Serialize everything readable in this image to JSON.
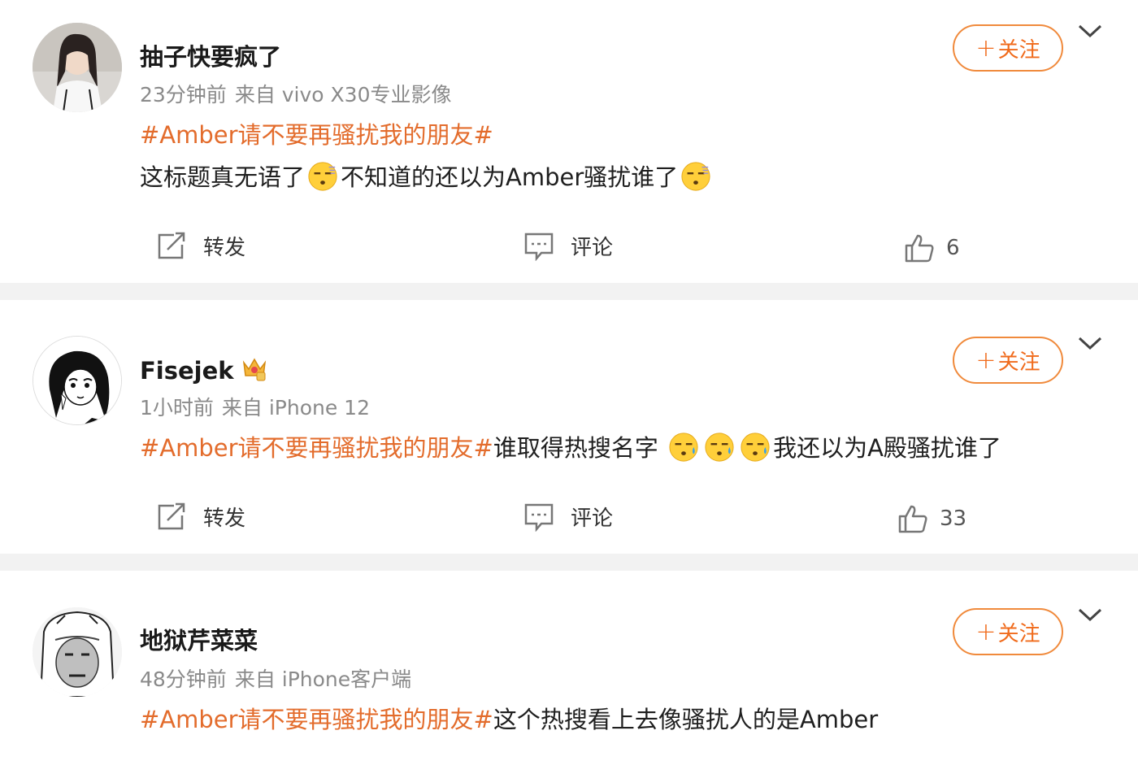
{
  "labels": {
    "follow": "关注",
    "repost": "转发",
    "comment": "评论"
  },
  "colors": {
    "accent": "#e36c2c",
    "separator": "#f2f2f2",
    "meta": "#8a8a8a"
  },
  "posts": [
    {
      "user": "抽子快要疯了",
      "time": "23分钟前",
      "source": "来自 vivo X30专业影像",
      "hashtag": "#Amber请不要再骚扰我的朋友#",
      "text_a": "这标题真无语了",
      "text_b": "不知道的还以为Amber骚扰谁了",
      "likes": "6"
    },
    {
      "user": "Fisejek",
      "badge_icon": "crown-icon",
      "time": "1小时前",
      "source": "来自 iPhone 12",
      "hashtag": "#Amber请不要再骚扰我的朋友#",
      "text_a": "谁取得热搜名字",
      "text_b": "我还以为A殿骚扰谁了",
      "likes": "33"
    },
    {
      "user": "地狱芹菜菜",
      "time": "48分钟前",
      "source": "来自 iPhone客户端",
      "hashtag": "#Amber请不要再骚扰我的朋友#",
      "text_a": "这个热搜看上去像骚扰人的是Amber"
    }
  ]
}
